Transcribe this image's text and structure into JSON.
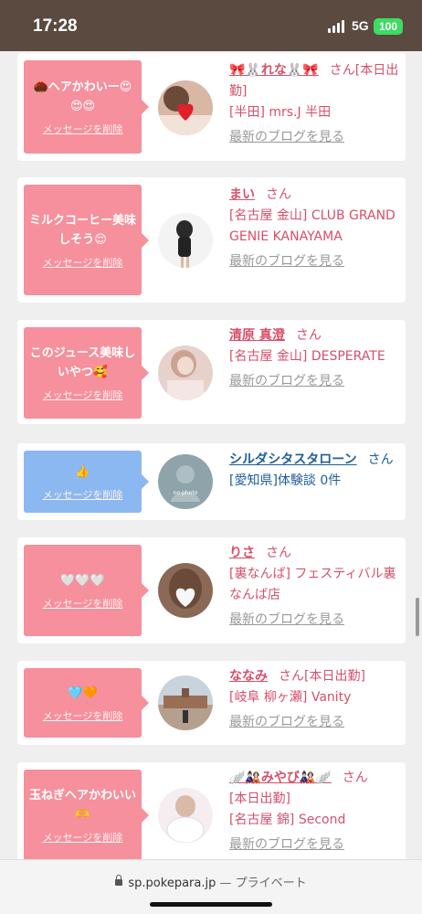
{
  "status": {
    "time": "17:28",
    "network": "5G",
    "battery": "100"
  },
  "messages": [
    {
      "bubble": "🌰ヘアかわいー😍😍😍",
      "delete": "メッセージを削除",
      "name": "🎀🐰れな🐰🎀",
      "san": "さん",
      "status": "[本日出勤]",
      "shop": "[半田] mrs.J 半田",
      "blog": "最新のブログを見る",
      "color": "pink"
    },
    {
      "bubble": "ミルクコーヒー美味しそう😌",
      "delete": "メッセージを削除",
      "name": "まい",
      "san": "さん",
      "status": "",
      "shop": "[名古屋 金山] CLUB GRAND GENIE KANAYAMA",
      "blog": "最新のブログを見る",
      "color": "pink"
    },
    {
      "bubble": "このジュース美味しいやつ🥰",
      "delete": "メッセージを削除",
      "name": "清原 真澄",
      "san": "さん",
      "status": "",
      "shop": "[名古屋 金山] DESPERATE",
      "blog": "最新のブログを見る",
      "color": "pink"
    },
    {
      "bubble": "👍",
      "delete": "メッセージを削除",
      "name": "シルダシタスタローン",
      "san": "さん",
      "status": "",
      "shop": "[愛知県]体験談 0件",
      "blog": "",
      "color": "blue"
    },
    {
      "bubble": "🤍🤍🤍",
      "delete": "メッセージを削除",
      "name": "りさ",
      "san": "さん",
      "status": "",
      "shop": "[裏なんば] フェスティバル裏なんば店",
      "blog": "最新のブログを見る",
      "color": "pink"
    },
    {
      "bubble": "🩵🧡",
      "delete": "メッセージを削除",
      "name": "ななみ",
      "san": "さん",
      "status": "[本日出勤]",
      "shop": "[岐阜 柳ヶ瀬] Vanity",
      "blog": "最新のブログを見る",
      "color": "pink"
    },
    {
      "bubble": "玉ねぎヘアかわいい🫶",
      "delete": "メッセージを削除",
      "name": "🪽🎎みやび🎎🪽",
      "san": "さん",
      "status": "[本日出勤]",
      "shop": "[名古屋 錦] Second",
      "blog": "最新のブログを見る",
      "color": "pink"
    }
  ],
  "url_bar": {
    "domain": "sp.pokepara.jp",
    "suffix": " — プライベート"
  }
}
